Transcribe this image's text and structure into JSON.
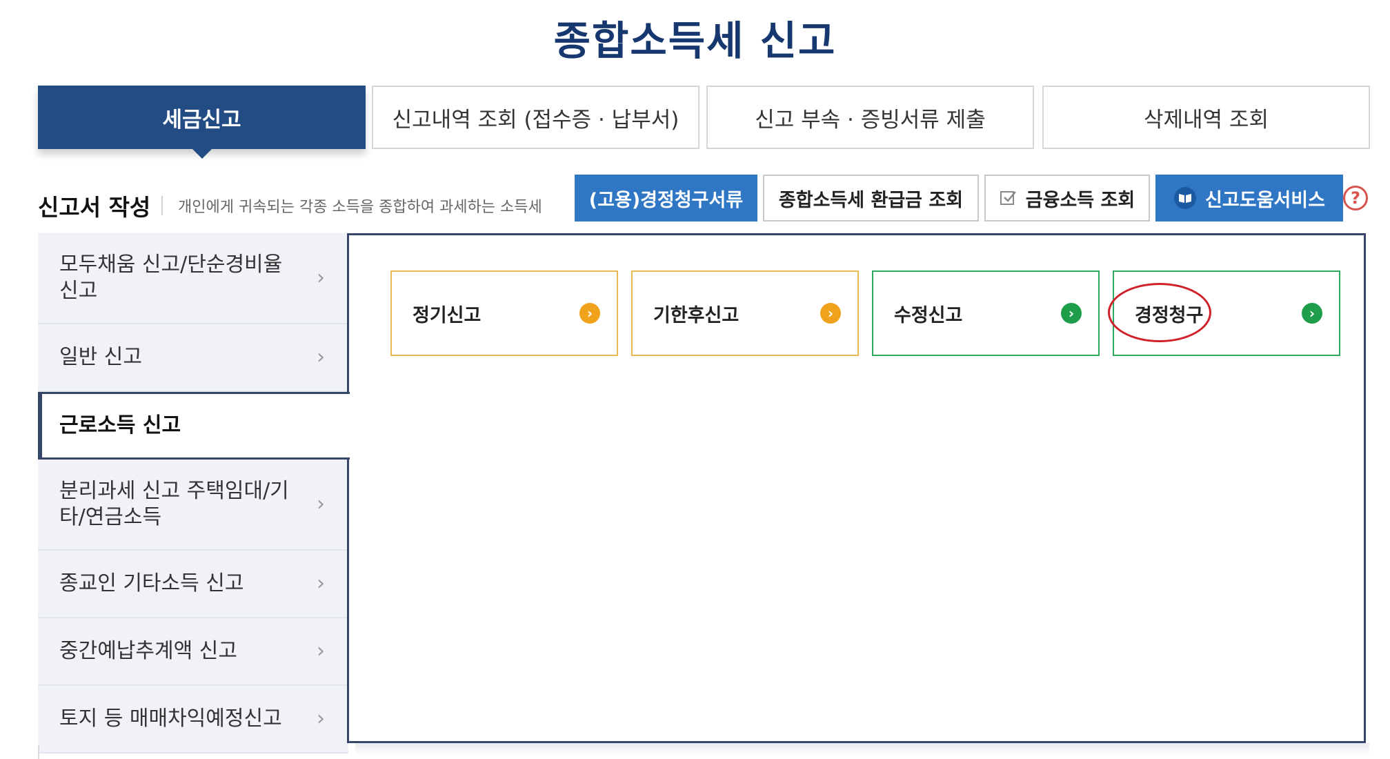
{
  "page": {
    "title": "종합소득세 신고"
  },
  "top_tabs": [
    {
      "label": "세금신고",
      "active": true
    },
    {
      "label": "신고내역 조회 (접수증 · 납부서)",
      "active": false
    },
    {
      "label": "신고 부속 · 증빙서류 제출",
      "active": false
    },
    {
      "label": "삭제내역 조회",
      "active": false
    }
  ],
  "section": {
    "title": "신고서 작성",
    "description": "개인에게 귀속되는 각종 소득을 종합하여 과세하는 소득세"
  },
  "actions": {
    "correction_docs": "(고용)경정청구서류",
    "refund_lookup": "종합소득세 환급금 조회",
    "financial_income": "금융소득 조회",
    "help_service": "신고도움서비스",
    "help_icon": "?"
  },
  "left_menu": [
    {
      "label": "모두채움 신고/단순경비율 신고",
      "active": false
    },
    {
      "label": "일반 신고",
      "active": false
    },
    {
      "label": "근로소득 신고",
      "active": true
    },
    {
      "label": "분리과세 신고 주택임대/기타/연금소득",
      "active": false
    },
    {
      "label": "종교인 기타소득 신고",
      "active": false
    },
    {
      "label": "중간예납추계액 신고",
      "active": false
    },
    {
      "label": "토지 등 매매차익예정신고",
      "active": false
    }
  ],
  "cards": [
    {
      "label": "정기신고",
      "color": "#f0a21d"
    },
    {
      "label": "기한후신고",
      "color": "#f0a21d"
    },
    {
      "label": "수정신고",
      "color": "#1e9d4a"
    },
    {
      "label": "경정청구",
      "color": "#1e9d4a",
      "highlighted": true
    }
  ],
  "icons": {
    "chevron": "chevron-right-icon",
    "check": "check-icon",
    "book": "book-icon",
    "help": "help-icon"
  },
  "colors": {
    "brand": "#17386f",
    "tab_active": "#244c84",
    "button_blue": "#2f77c4",
    "panel_border": "#36466b",
    "highlight": "#d0202a"
  }
}
